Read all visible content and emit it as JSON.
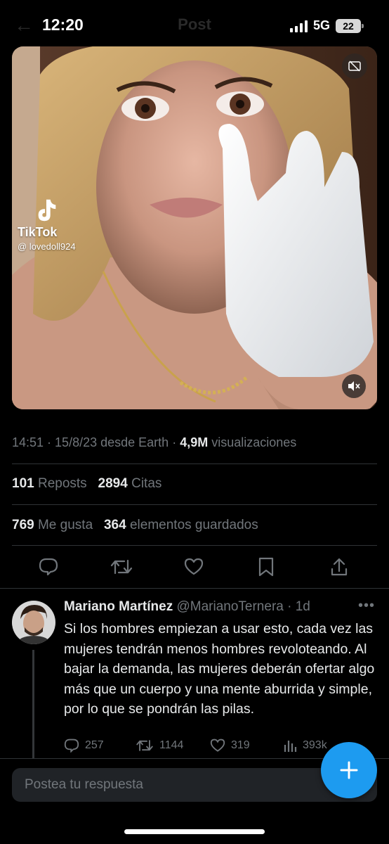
{
  "status_bar": {
    "time": "12:20",
    "network": "5G",
    "battery": "22"
  },
  "header": {
    "ghost_title": "Post"
  },
  "media": {
    "watermark_brand": "TikTok",
    "watermark_handle": "@ lovedoll924",
    "icons": [
      "captions-icon",
      "mute-icon"
    ]
  },
  "post_meta": {
    "time": "14:51",
    "date": "15/8/23",
    "source": "desde Earth",
    "views_count": "4,9M",
    "views_label": "visualizaciones"
  },
  "stats": {
    "reposts_count": "101",
    "reposts_label": "Reposts",
    "quotes_count": "2894",
    "quotes_label": "Citas",
    "likes_count": "769",
    "likes_label": "Me gusta",
    "bookmarks_count": "364",
    "bookmarks_label": "elementos guardados"
  },
  "actions": [
    "reply-icon",
    "retweet-icon",
    "like-icon",
    "bookmark-icon",
    "share-icon"
  ],
  "reply": {
    "name": "Mariano Martínez",
    "handle": "@MarianoTernera",
    "separator": "·",
    "time": "1d",
    "more": "•••",
    "text": "Si los hombres empiezan a usar esto, cada vez las mujeres tendrán menos hombres revoloteando. Al bajar la demanda, las mujeres deberán ofertar algo más que un cuerpo y una mente aburrida y simple, por lo que se pondrán las pilas.",
    "replies": "257",
    "reposts": "1144",
    "likes": "319",
    "views": "393k"
  },
  "compose": {
    "placeholder": "Postea tu respuesta"
  },
  "colors": {
    "accent": "#1d9bf0",
    "background": "#000000",
    "secondary_text": "#71767b",
    "divider": "#2f3336"
  }
}
